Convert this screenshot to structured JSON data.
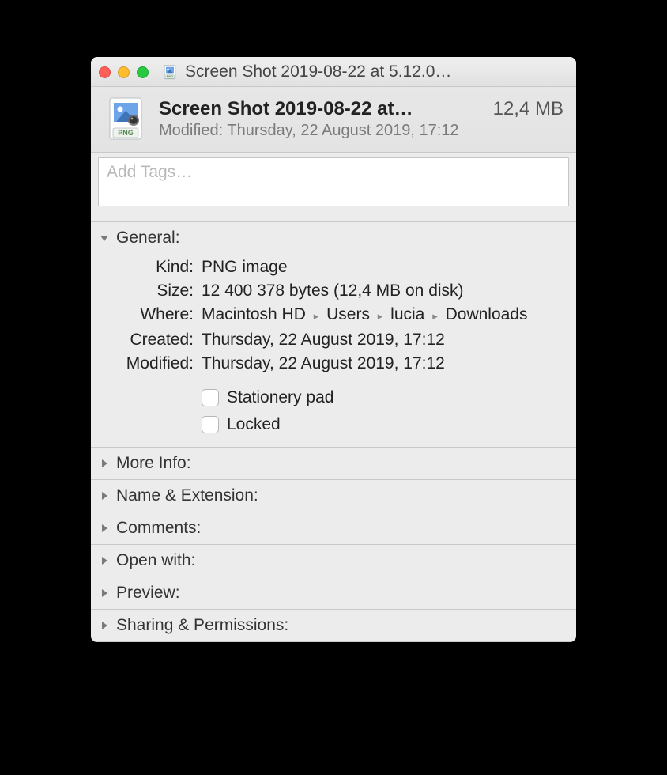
{
  "titlebar": {
    "title": "Screen Shot 2019-08-22 at 5.12.0…"
  },
  "header": {
    "filename": "Screen Shot 2019-08-22 at…",
    "filesize": "12,4 MB",
    "modified_label": "Modified:",
    "modified_value": "Thursday, 22 August 2019, 17:12",
    "icon_badge": "PNG"
  },
  "tags": {
    "placeholder": "Add Tags…"
  },
  "sections": {
    "general": {
      "title": "General:",
      "kind_label": "Kind:",
      "kind_value": "PNG image",
      "size_label": "Size:",
      "size_value": "12 400 378 bytes (12,4 MB on disk)",
      "where_label": "Where:",
      "where_parts": [
        "Macintosh HD",
        "Users",
        "lucia",
        "Downloads"
      ],
      "created_label": "Created:",
      "created_value": "Thursday, 22 August 2019, 17:12",
      "modified_label": "Modified:",
      "modified_value": "Thursday, 22 August 2019, 17:12",
      "stationery_label": "Stationery pad",
      "locked_label": "Locked"
    },
    "more_info": "More Info:",
    "name_ext": "Name & Extension:",
    "comments": "Comments:",
    "open_with": "Open with:",
    "preview": "Preview:",
    "sharing": "Sharing & Permissions:"
  }
}
